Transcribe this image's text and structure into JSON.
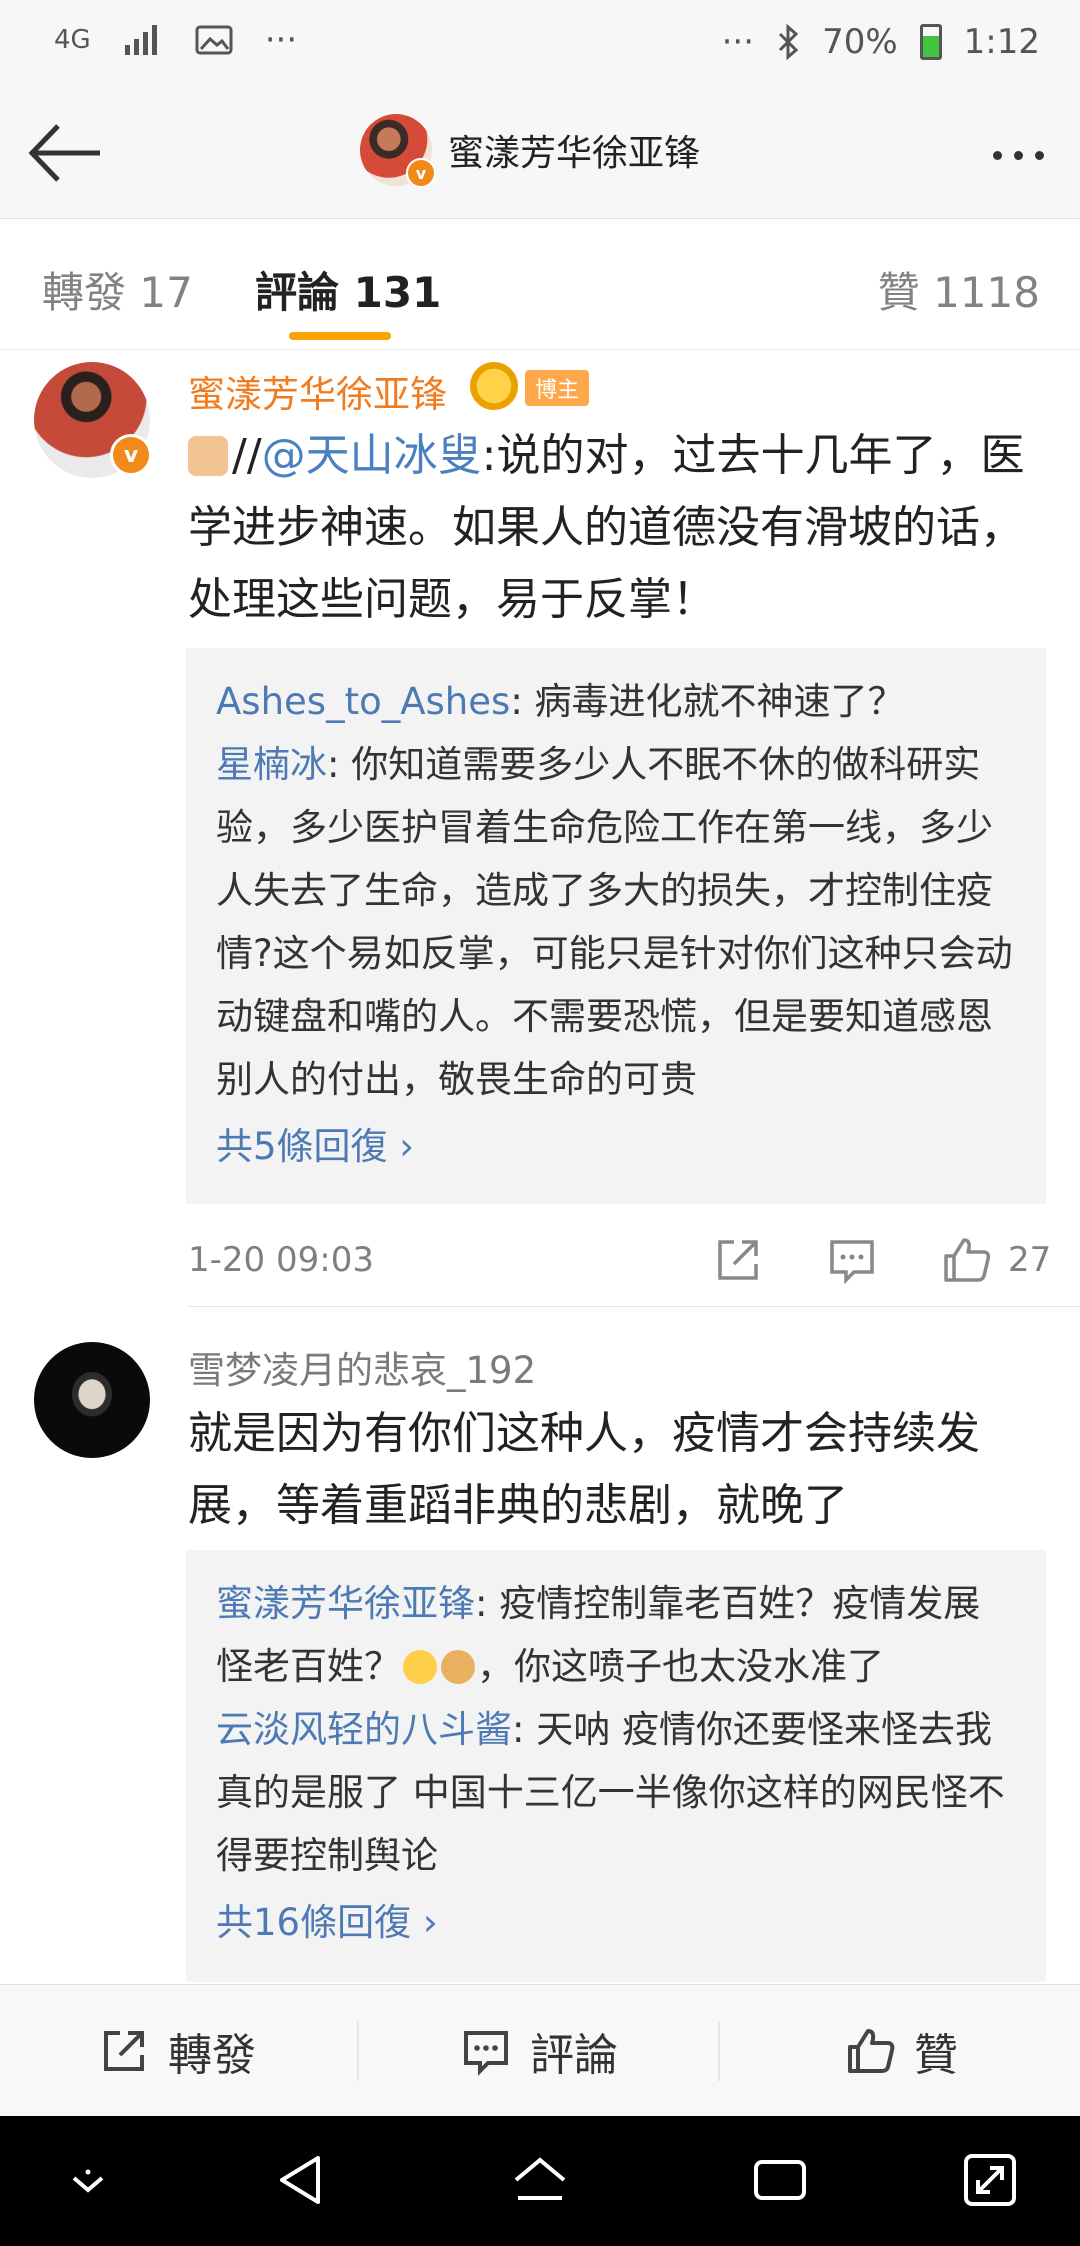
{
  "status_bar": {
    "network": "4G",
    "battery_percent": "70%",
    "battery_level": 0.7,
    "time": "1:12",
    "left_more": "···",
    "right_more": "···"
  },
  "header": {
    "title": "蜜漾芳华徐亚锋",
    "verified_badge": "v"
  },
  "tabs": {
    "repost": "轉發 17",
    "comment": "評論 131",
    "like": "贊 1118"
  },
  "comments": [
    {
      "username": "蜜漾芳华徐亚锋",
      "author_tag": "博主",
      "text_prefix": "//",
      "mention": "@天山冰叟",
      "text": ":说的对，过去十几年了，医学进步神速。如果人的道德没有滑坡的话，处理这些问题，易于反掌！",
      "replies": [
        {
          "user": "Ashes_to_Ashes",
          "text": ": 病毒进化就不神速了？"
        },
        {
          "user": "星楠冰",
          "text": ": 你知道需要多少人不眠不休的做科研实验，多少医护冒着生命危险工作在第一线，多少人失去了生命，造成了多大的损失，才控制住疫情?这个易如反掌，可能只是针对你们这种只会动动键盘和嘴的人。不需要恐慌，但是要知道感恩别人的付出，敬畏生命的可贵"
        }
      ],
      "more_replies": "共5條回復 ›",
      "timestamp": "1-20 09:03",
      "likes": "27"
    },
    {
      "username": "雪梦凌月的悲哀_192",
      "text": "就是因为有你们这种人，疫情才会持续发展，等着重蹈非典的悲剧，就晚了",
      "replies": [
        {
          "user": "蜜漾芳华徐亚锋",
          "text": ": 疫情控制靠老百姓？疫情发展怪老百姓？",
          "text_after": "，你这喷子也太没水准了"
        },
        {
          "user": "云淡风轻的八斗酱",
          "text": ": 天呐 疫情你还要怪来怪去我真的是服了 中国十三亿一半像你这样的网民怪不得要控制舆论"
        }
      ],
      "more_replies": "共16條回復 ›"
    }
  ],
  "bottom_bar": {
    "repost": "轉發",
    "comment": "評論",
    "like": "贊"
  },
  "colors": {
    "accent_orange": "#f7a300",
    "link_blue": "#4d7ab5",
    "author_orange": "#f17b1d"
  }
}
